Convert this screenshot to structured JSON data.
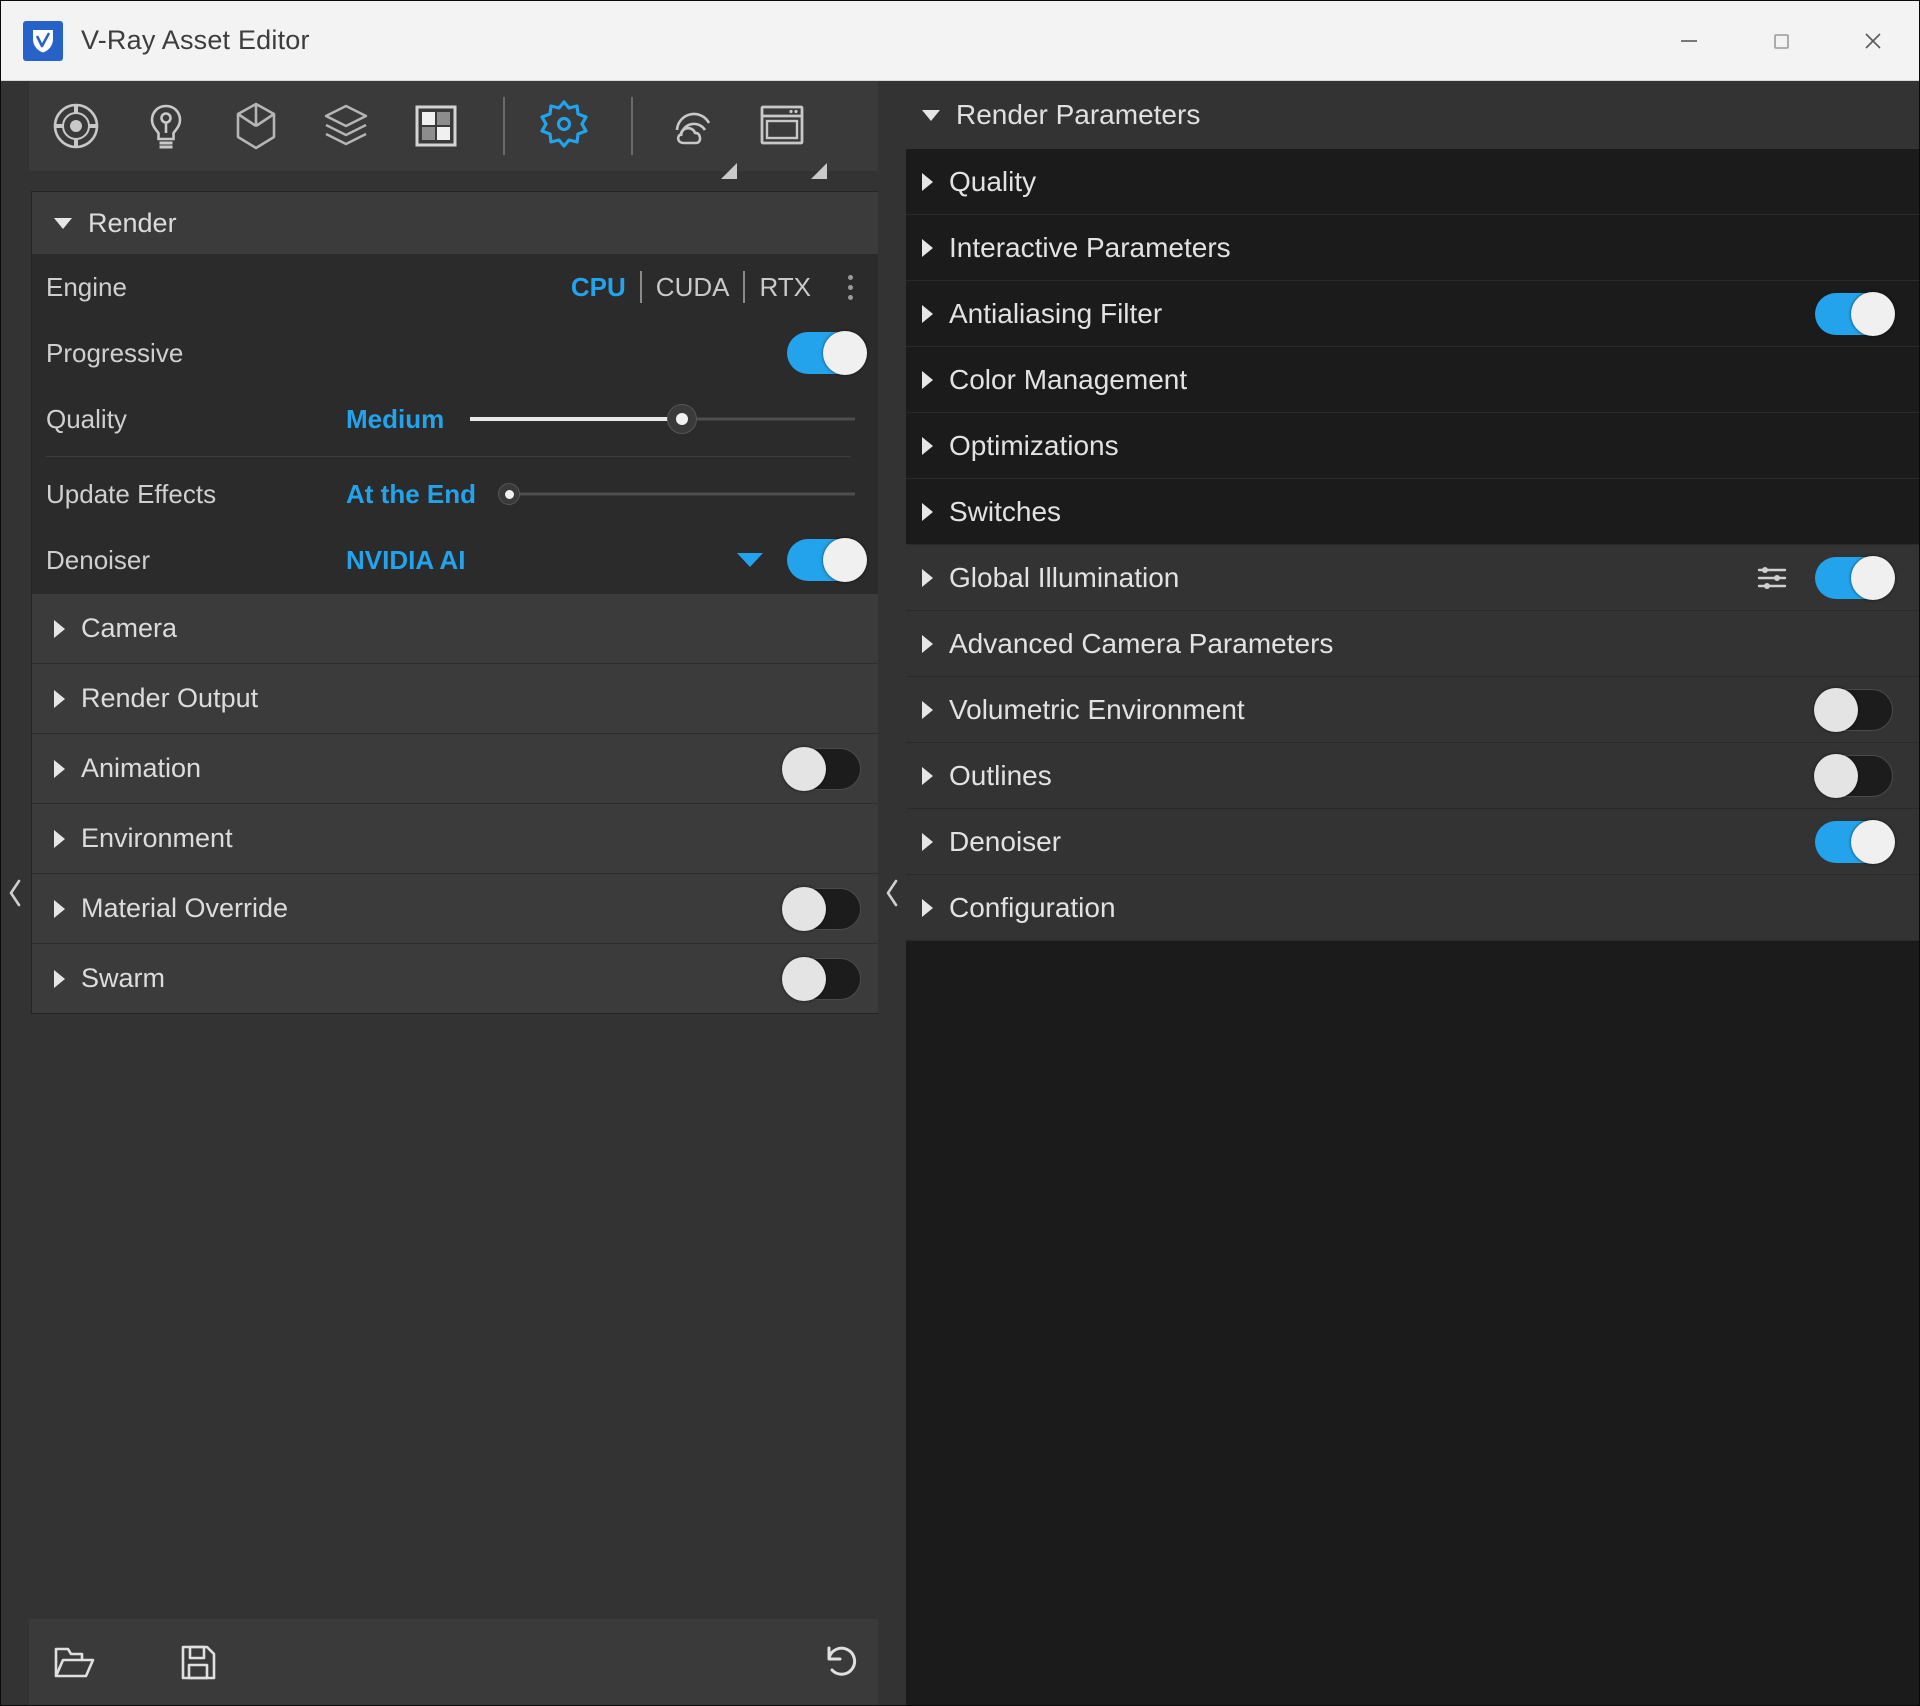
{
  "window": {
    "title": "V-Ray Asset Editor",
    "logo_icon": "vray-logo-icon",
    "minimize_label": "—",
    "maximize_label": "□",
    "close_label": "✕",
    "accent_color": "#23a3ec",
    "titlebar_bg": "#f3f3f3"
  },
  "toolbar": {
    "items": [
      {
        "name": "materials-sphere-icon",
        "label": "Materials",
        "active": false
      },
      {
        "name": "lights-bulb-icon",
        "label": "Lights",
        "active": false
      },
      {
        "name": "geometry-cube-icon",
        "label": "Geometry",
        "active": false
      },
      {
        "name": "render-elements-layers-icon",
        "label": "Render Elements",
        "active": false
      },
      {
        "name": "textures-grid-icon",
        "label": "Textures",
        "active": false
      },
      {
        "name": "settings-gear-icon",
        "label": "Settings",
        "active": true
      },
      {
        "name": "cosmos-cloud-icon",
        "label": "Chaos Cosmos",
        "active": false
      },
      {
        "name": "vfb-window-icon",
        "label": "Frame Buffer",
        "active": false
      }
    ]
  },
  "left_panel": {
    "section": {
      "title": "Render",
      "expanded": true
    },
    "rows": {
      "engine": {
        "label": "Engine",
        "options": [
          "CPU",
          "CUDA",
          "RTX"
        ],
        "selected": "CPU",
        "overflow_icon": "kebab-menu-icon"
      },
      "progressive": {
        "label": "Progressive",
        "toggle_on": true
      },
      "quality": {
        "label": "Quality",
        "value": "Medium",
        "slider_percent": 55
      },
      "update_effects": {
        "label": "Update Effects",
        "value": "At the End",
        "slider_percent": 2
      },
      "denoiser": {
        "label": "Denoiser",
        "value": "NVIDIA AI",
        "dropdown_icon": "chevron-down-icon",
        "toggle_on": true
      }
    },
    "sections": [
      {
        "label": "Camera",
        "has_toggle": false,
        "toggle_on": false
      },
      {
        "label": "Render Output",
        "has_toggle": false,
        "toggle_on": false
      },
      {
        "label": "Animation",
        "has_toggle": true,
        "toggle_on": false
      },
      {
        "label": "Environment",
        "has_toggle": false,
        "toggle_on": false
      },
      {
        "label": "Material Override",
        "has_toggle": true,
        "toggle_on": false
      },
      {
        "label": "Swarm",
        "has_toggle": true,
        "toggle_on": false
      }
    ],
    "bottom_bar": [
      {
        "name": "open-folder-icon",
        "label": "Load Render Settings"
      },
      {
        "name": "save-floppy-icon",
        "label": "Save Render Settings"
      },
      {
        "name": "revert-undo-icon",
        "label": "Revert to Default Render Settings"
      }
    ],
    "collapse_left_icon": "chevron-left-icon",
    "collapse_right_icon": "chevron-left-icon"
  },
  "right_panel": {
    "header": {
      "label": "Render Parameters",
      "expanded": true
    },
    "sections": [
      {
        "label": "Quality",
        "has_toggle": false,
        "toggle_on": false,
        "has_settings_icon": false,
        "alt_bg": false
      },
      {
        "label": "Interactive Parameters",
        "has_toggle": false,
        "toggle_on": false,
        "has_settings_icon": false,
        "alt_bg": false
      },
      {
        "label": "Antialiasing Filter",
        "has_toggle": true,
        "toggle_on": true,
        "has_settings_icon": false,
        "alt_bg": false
      },
      {
        "label": "Color Management",
        "has_toggle": false,
        "toggle_on": false,
        "has_settings_icon": false,
        "alt_bg": false
      },
      {
        "label": "Optimizations",
        "has_toggle": false,
        "toggle_on": false,
        "has_settings_icon": false,
        "alt_bg": false
      },
      {
        "label": "Switches",
        "has_toggle": false,
        "toggle_on": false,
        "has_settings_icon": false,
        "alt_bg": false
      },
      {
        "label": "Global Illumination",
        "has_toggle": true,
        "toggle_on": true,
        "has_settings_icon": true,
        "alt_bg": true
      },
      {
        "label": "Advanced Camera Parameters",
        "has_toggle": false,
        "toggle_on": false,
        "has_settings_icon": false,
        "alt_bg": true
      },
      {
        "label": "Volumetric Environment",
        "has_toggle": true,
        "toggle_on": false,
        "has_settings_icon": false,
        "alt_bg": true
      },
      {
        "label": "Outlines",
        "has_toggle": true,
        "toggle_on": false,
        "has_settings_icon": false,
        "alt_bg": true
      },
      {
        "label": "Denoiser",
        "has_toggle": true,
        "toggle_on": true,
        "has_settings_icon": false,
        "alt_bg": true
      },
      {
        "label": "Configuration",
        "has_toggle": false,
        "toggle_on": false,
        "has_settings_icon": false,
        "alt_bg": true
      }
    ]
  }
}
